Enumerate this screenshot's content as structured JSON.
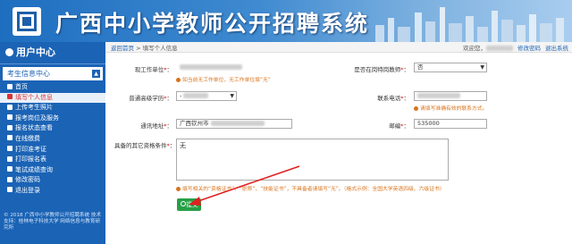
{
  "banner": {
    "title": "广西中小学教师公开招聘系统"
  },
  "sidebar": {
    "header": "用户中心",
    "group": "考生信息中心",
    "items": [
      {
        "label": "首页",
        "active": false
      },
      {
        "label": "填写个人信息",
        "active": true
      },
      {
        "label": "上传考生照片",
        "active": false
      },
      {
        "label": "报考岗位及服务",
        "active": false
      },
      {
        "label": "报名状态查看",
        "active": false
      },
      {
        "label": "在线缴费",
        "active": false
      },
      {
        "label": "打印准考证",
        "active": false
      },
      {
        "label": "打印报名表",
        "active": false
      },
      {
        "label": "笔试成绩查询",
        "active": false
      },
      {
        "label": "修改密码",
        "active": false
      },
      {
        "label": "退出登录",
        "active": false
      }
    ],
    "footer": "© 2018 广西中小学教师公开招聘系统 技术支持：桂林电子科技大学 网络信息与教育研究所"
  },
  "breadcrumb": {
    "home": "返回首页",
    "separator": " > ",
    "current": "填写个人信息"
  },
  "topbar": {
    "welcome": "欢迎您，",
    "link1": "修改密码",
    "link2": "退出系统"
  },
  "form": {
    "work_unit": {
      "label": "现工作单位",
      "hint": "如当前无工作单位，无工作单位填“无”"
    },
    "is_special": {
      "label": "是否在岗特岗教师",
      "value": "否"
    },
    "degree": {
      "label": "普通高级学历",
      "value": "-"
    },
    "phone": {
      "label": "联系电话"
    },
    "phone_hint": "请填写准确有效的联系方式。",
    "address": {
      "label": "通讯地址",
      "value": "广西钦州市"
    },
    "postcode": {
      "label": "邮编",
      "value": "535000"
    },
    "other": {
      "label": "具备的其它资格条件",
      "value": "无",
      "hint": "填写相关的“资格证书”、“职称”、“技能证书”，不具备者请填写“无”。（格式示例：全国大学英语四级、六级证书）"
    },
    "submit_label": "提交"
  },
  "colors": {
    "sidebar": "#1b63b5",
    "hint": "#d9731c",
    "submit": "#27a046",
    "arrow": "#e02020"
  }
}
